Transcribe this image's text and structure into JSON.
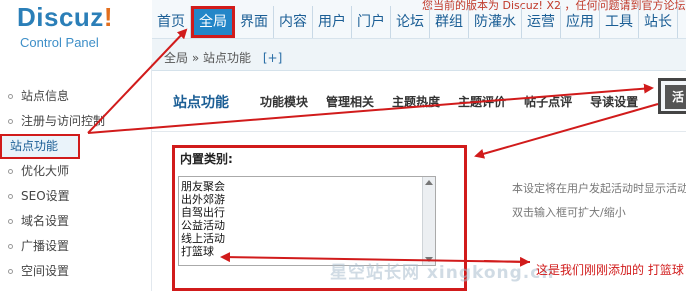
{
  "logo": {
    "brand": "Discuz",
    "brand_mark": "!",
    "subtitle": "Control Panel"
  },
  "topnav": {
    "notice": "您当前的版本为 Discuz! X2 ，任何问题请到官方论坛",
    "items": [
      "首页",
      "全局",
      "界面",
      "内容",
      "用户",
      "门户",
      "论坛",
      "群组",
      "防灌水",
      "运营",
      "应用",
      "工具",
      "站长"
    ],
    "active_index": 1
  },
  "breadcrumb": {
    "root": "全局",
    "separator": "»",
    "current": "站点功能",
    "add": "[+]"
  },
  "sidebar": {
    "items": [
      "站点信息",
      "注册与访问控制",
      "站点功能",
      "优化大师",
      "SEO设置",
      "域名设置",
      "广播设置",
      "空间设置"
    ],
    "current_index": 2
  },
  "section": {
    "title": "站点功能",
    "tabs": [
      "功能模块",
      "管理相关",
      "主题热度",
      "主题评价",
      "帖子点评",
      "导读设置"
    ],
    "active_tab_fragment": "活"
  },
  "field": {
    "label": "内置类别:",
    "lines": [
      "朋友聚会",
      "出外郊游",
      "自驾出行",
      "公益活动",
      "线上活动",
      "打篮球"
    ],
    "hint_line1": "本设定将在用户发起活动时显示活动类别",
    "hint_line2": "双击输入框可扩大/缩小"
  },
  "annotation": "这是我们刚刚添加的  打篮球",
  "watermark": "星空站长网 xingkong.cn",
  "colors": {
    "accent": "#2386c8",
    "highlight": "#d11b1b",
    "brand": "#2b7fb8"
  },
  "icons": {
    "scroll_up": "triangle-up-icon",
    "scroll_down": "triangle-down-icon"
  }
}
